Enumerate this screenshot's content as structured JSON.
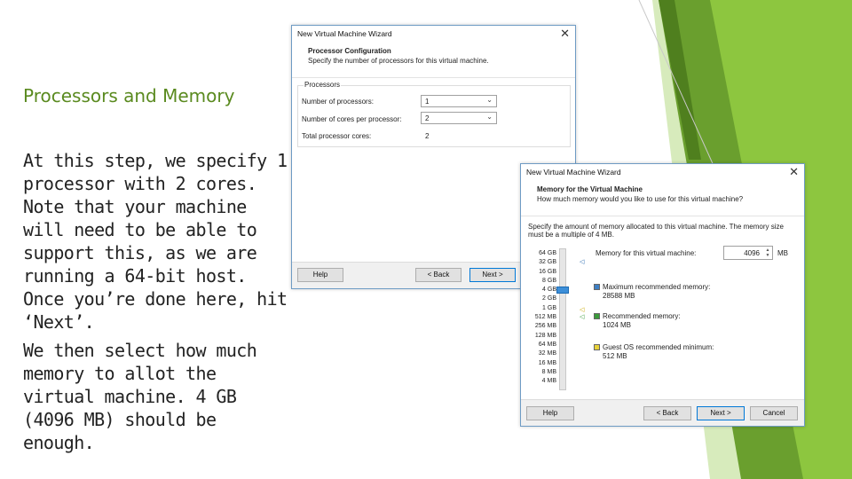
{
  "slide": {
    "title": "Processors and Memory",
    "paragraph1": "At this step, we specify 1 processor with 2 cores. Note that your machine will need to be able to support this, as we are running a 64-bit host. Once you’re done here, hit ‘Next’.",
    "paragraph2": "We then select how much memory to allot the virtual machine. 4 GB (4096 MB) should be enough."
  },
  "colors": {
    "accent_green": "#8dc63f",
    "dark_green": "#5a8a1f",
    "dialog_border": "#6e9bc4"
  },
  "dialog1": {
    "title": "New Virtual Machine Wizard",
    "close_icon": "close-icon",
    "header_title": "Processor Configuration",
    "header_sub": "Specify the number of processors for this virtual machine.",
    "group_label": "Processors",
    "num_processors_label": "Number of processors:",
    "num_processors_value": "1",
    "cores_label": "Number of cores per processor:",
    "cores_value": "2",
    "total_label": "Total processor cores:",
    "total_value": "2",
    "help_label": "Help",
    "back_label": "< Back",
    "next_label": "Next >"
  },
  "dialog2": {
    "title": "New Virtual Machine Wizard",
    "close_icon": "close-icon",
    "header_title": "Memory for the Virtual Machine",
    "header_sub": "How much memory would you like to use for this virtual machine?",
    "description": "Specify the amount of memory allocated to this virtual machine. The memory size must be a multiple of 4 MB.",
    "scale": [
      "64 GB",
      "32 GB",
      "16 GB",
      "8 GB",
      "4 GB",
      "2 GB",
      "1 GB",
      "512 MB",
      "256 MB",
      "128 MB",
      "64 MB",
      "32 MB",
      "16 MB",
      "8 MB",
      "4 MB"
    ],
    "memory_label": "Memory for this virtual machine:",
    "memory_value": "4096",
    "memory_unit": "MB",
    "max_label": "Maximum recommended memory:",
    "max_value": "28588 MB",
    "rec_label": "Recommended memory:",
    "rec_value": "1024 MB",
    "min_label": "Guest OS recommended minimum:",
    "min_value": "512 MB",
    "help_label": "Help",
    "back_label": "< Back",
    "next_label": "Next >",
    "cancel_label": "Cancel"
  }
}
